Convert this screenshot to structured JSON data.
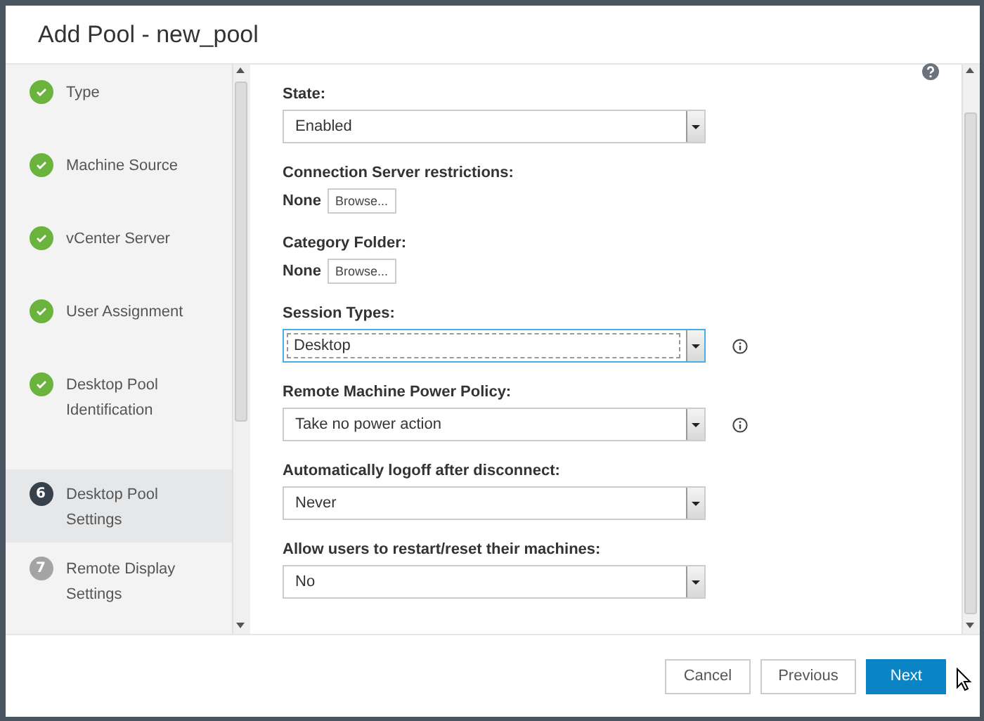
{
  "dialog": {
    "title": "Add Pool - new_pool"
  },
  "steps": [
    {
      "label": "Type",
      "completed": true,
      "selected": false
    },
    {
      "label": "Machine Source",
      "completed": true,
      "selected": false
    },
    {
      "label": "vCenter Server",
      "completed": true,
      "selected": false
    },
    {
      "label": "User Assignment",
      "completed": true,
      "selected": false
    },
    {
      "label": "Desktop Pool Identification",
      "completed": true,
      "selected": false
    },
    {
      "label": "Desktop Pool Settings",
      "number": "6",
      "completed": false,
      "selected": true
    },
    {
      "label": "Remote Display Settings",
      "number": "7",
      "completed": false,
      "selected": false
    }
  ],
  "fields": [
    {
      "kind": "select",
      "label": "State:",
      "value": "Enabled",
      "focused": false,
      "info": false
    },
    {
      "kind": "browse",
      "label": "Connection Server restrictions:",
      "value": "None",
      "button": "Browse..."
    },
    {
      "kind": "browse",
      "label": "Category Folder:",
      "value": "None",
      "button": "Browse..."
    },
    {
      "kind": "select",
      "label": "Session Types:",
      "value": "Desktop",
      "focused": true,
      "info": true
    },
    {
      "kind": "select",
      "label": "Remote Machine Power Policy:",
      "value": "Take no power action",
      "focused": false,
      "info": true
    },
    {
      "kind": "select",
      "label": "Automatically logoff after disconnect:",
      "value": "Never",
      "focused": false,
      "info": false
    },
    {
      "kind": "select",
      "label": "Allow users to restart/reset their machines:",
      "value": "No",
      "focused": false,
      "info": false
    }
  ],
  "buttons": [
    {
      "label": "Cancel",
      "primary": false
    },
    {
      "label": "Previous",
      "primary": false
    },
    {
      "label": "Next",
      "primary": true
    }
  ]
}
